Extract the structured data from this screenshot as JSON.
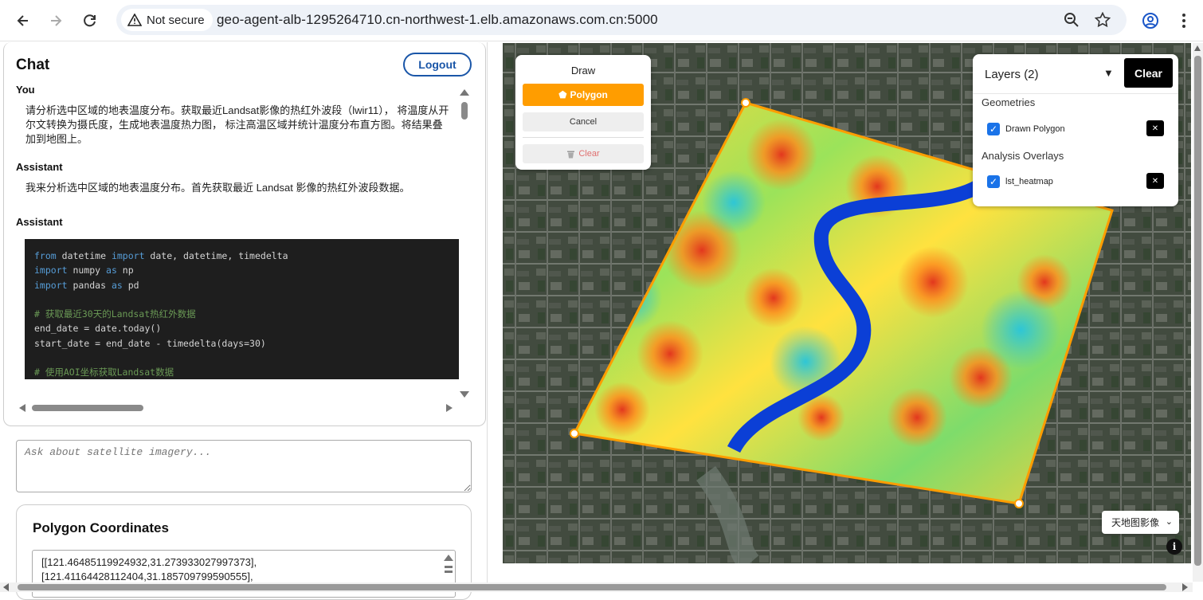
{
  "browser": {
    "security_label": "Not secure",
    "url": "geo-agent-alb-1295264710.cn-northwest-1.elb.amazonaws.com.cn:5000"
  },
  "chat": {
    "title": "Chat",
    "logout_label": "Logout",
    "messages": [
      {
        "role": "You",
        "text": "请分析选中区域的地表温度分布。获取最近Landsat影像的热红外波段（lwir11）， 将温度从开尔文转换为摄氏度，生成地表温度热力图， 标注高温区域并统计温度分布直方图。将结果叠加到地图上。"
      },
      {
        "role": "Assistant",
        "text": "我来分析选中区域的地表温度分布。首先获取最近 Landsat 影像的热红外波段数据。"
      },
      {
        "role": "Assistant",
        "text": ""
      }
    ],
    "code_lines": [
      "from datetime import date, datetime, timedelta",
      "import numpy as np",
      "import pandas as pd",
      "",
      "# 获取最近30天的Landsat热红外数据",
      "end_date = date.today()",
      "start_date = end_date - timedelta(days=30)",
      "",
      "# 使用AOI坐标获取Landsat数据"
    ],
    "input_placeholder": "Ask about satellite imagery..."
  },
  "polygon": {
    "title": "Polygon Coordinates",
    "coords_text": "[[121.46485119924932,31.273933027997373],\n[121.41164428112404,31.185709799590555],"
  },
  "draw": {
    "title": "Draw",
    "polygon_label": "Polygon",
    "cancel_label": "Cancel",
    "clear_label": "Clear"
  },
  "layers": {
    "header": "Layers (2)",
    "clear_label": "Clear",
    "sections": [
      {
        "title": "Geometries",
        "items": [
          {
            "name": "Drawn Polygon",
            "checked": true
          }
        ]
      },
      {
        "title": "Analysis Overlays",
        "items": [
          {
            "name": "lst_heatmap",
            "checked": true
          }
        ]
      }
    ]
  },
  "map": {
    "basemap_label": "天地图影像",
    "polygon_color": "#ff9d00",
    "river_color": "#0b3fd6"
  }
}
